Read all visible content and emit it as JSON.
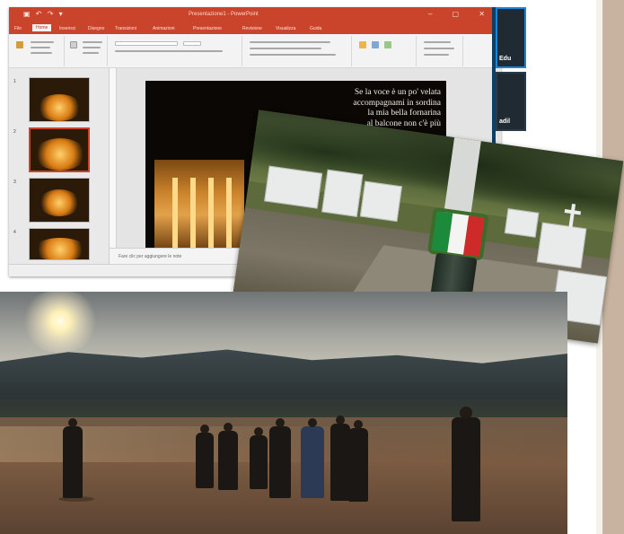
{
  "powerpoint": {
    "window_title": "Presentazione1 - PowerPoint",
    "tabs": [
      "File",
      "Home",
      "Inserisci",
      "Disegno",
      "Transizioni",
      "Animazioni",
      "Presentazione",
      "Revisione",
      "Visualizza",
      "Guida"
    ],
    "active_tab": "Home",
    "slide_text_lines": [
      "Se la voce è un po' velata",
      "accompagnami in sordina",
      "la mia bella fornarina",
      "al balcone non c'è più"
    ],
    "notes_placeholder": "Fare clic per aggiungere le note",
    "thumbnail_numbers": [
      "1",
      "2",
      "3",
      "4"
    ],
    "accent_color": "#c9442b"
  },
  "video_call": {
    "participant_name_1": "Edu",
    "participant_name_2": "adil"
  }
}
